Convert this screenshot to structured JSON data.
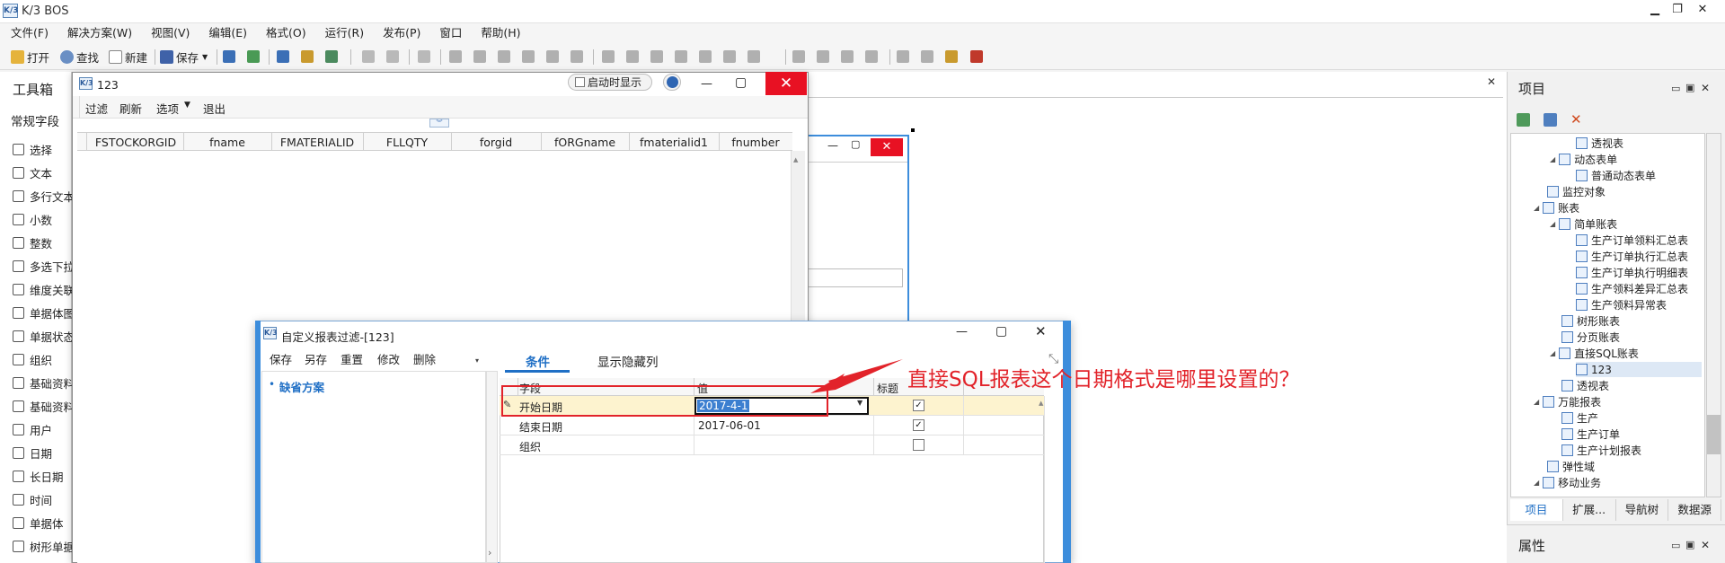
{
  "app": {
    "logo": "K/3",
    "title": "K/3 BOS"
  },
  "window_controls": [
    "▁",
    "❐",
    "✕"
  ],
  "menu": [
    "文件(F)",
    "解决方案(W)",
    "视图(V)",
    "编辑(E)",
    "格式(O)",
    "运行(R)",
    "发布(P)",
    "窗口",
    "帮助(H)"
  ],
  "toolbar": {
    "open": "打开",
    "find": "查找",
    "new": "新建",
    "save": "保存"
  },
  "left_panel": {
    "title": "工具箱",
    "section": "常规字段",
    "items": [
      "选择",
      "文本",
      "多行文本",
      "小数",
      "整数",
      "多选下拉",
      "维度关联",
      "单据体图",
      "单据状态",
      "组织",
      "基础资料",
      "基础资料",
      "用户",
      "日期",
      "长日期",
      "时间",
      "单据体",
      "树形单据"
    ]
  },
  "designer_close": "✕",
  "right_panel": {
    "title": "项目",
    "properties_title": "属性",
    "tree": [
      {
        "label": "透视表",
        "level": 3
      },
      {
        "label": "动态表单",
        "level": 2,
        "expand": "◢"
      },
      {
        "label": "普通动态表单",
        "level": 3
      },
      {
        "label": "监控对象",
        "level": 1
      },
      {
        "label": "账表",
        "level": 1,
        "expand": "◢"
      },
      {
        "label": "简单账表",
        "level": 2,
        "expand": "◢"
      },
      {
        "label": "生产订单领料汇总表",
        "level": 3
      },
      {
        "label": "生产订单执行汇总表",
        "level": 3
      },
      {
        "label": "生产订单执行明细表",
        "level": 3
      },
      {
        "label": "生产领料差异汇总表",
        "level": 3
      },
      {
        "label": "生产领料异常表",
        "level": 3
      },
      {
        "label": "树形账表",
        "level": 2
      },
      {
        "label": "分页账表",
        "level": 2
      },
      {
        "label": "直接SQL账表",
        "level": 2,
        "expand": "◢"
      },
      {
        "label": "123",
        "level": 3,
        "selected": true
      },
      {
        "label": "透视表",
        "level": 2
      },
      {
        "label": "万能报表",
        "level": 1,
        "expand": "◢"
      },
      {
        "label": "生产",
        "level": 2
      },
      {
        "label": "生产订单",
        "level": 2
      },
      {
        "label": "生产计划报表",
        "level": 2
      },
      {
        "label": "弹性域",
        "level": 1
      },
      {
        "label": "移动业务",
        "level": 1,
        "expand": "◢"
      }
    ],
    "tabs": [
      "项目",
      "扩展...",
      "导航树",
      "数据源"
    ]
  },
  "report_window": {
    "logo": "K/3",
    "title": "123",
    "startup_label": "启动时显示",
    "menu": [
      "过滤",
      "刷新",
      "选项",
      "退出"
    ],
    "columns": [
      "FSTOCKORGID",
      "fname",
      "FMATERIALID",
      "FLLQTY",
      "forgid",
      "fORGname",
      "fmaterialid1",
      "fnumber"
    ]
  },
  "filter_dialog": {
    "logo": "K/3",
    "title": "自定义报表过滤-[123]",
    "toolbar": [
      "保存",
      "另存",
      "重置",
      "修改",
      "删除"
    ],
    "scheme": "缺省方案",
    "tabs": [
      "条件",
      "显示隐藏列"
    ],
    "grid_headers": [
      "字段",
      "值",
      "标题"
    ],
    "rows": [
      {
        "field": "开始日期",
        "value": "2017-4-1",
        "title_checked": true
      },
      {
        "field": "结束日期",
        "value": "2017-06-01",
        "title_checked": true
      },
      {
        "field": "组织",
        "value": "",
        "title_checked": false
      }
    ]
  },
  "annotation": {
    "text": "直接SQL报表这个日期格式是哪里设置的？",
    "color": "#e2232a"
  },
  "colors": {
    "accent": "#3c8ddc",
    "close": "#e81123",
    "highlight_row": "#fdf3cf"
  }
}
